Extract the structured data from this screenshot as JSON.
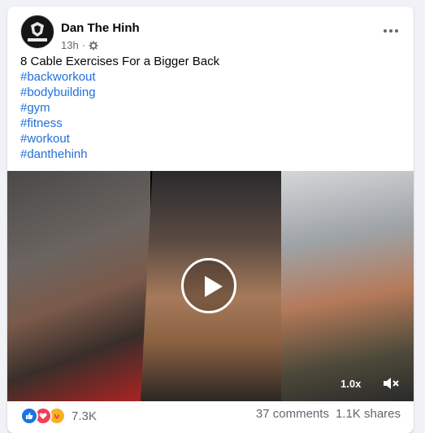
{
  "post": {
    "author": "Dan The Hinh",
    "avatar_text": "DAN THE HINH",
    "time": "13h",
    "privacy_icon": "settings-gear-icon",
    "text": "8 Cable Exercises For a Bigger Back",
    "hashtags": [
      "#backworkout",
      "#bodybuilding",
      "#gym",
      "#fitness",
      "#workout",
      "#danthehinh"
    ]
  },
  "video": {
    "playback_speed": "1.0x",
    "play_icon": "play-icon",
    "volume_icon": "volume-muted-icon"
  },
  "footer": {
    "reaction_icons": [
      "like-icon",
      "love-icon",
      "care-icon"
    ],
    "reaction_count": "7.3K",
    "comments": "37 comments",
    "shares": "1.1K shares"
  },
  "colors": {
    "hashtag": "#216fdb",
    "like": "#1b74e4",
    "love": "#f33e58",
    "care": "#f7b125"
  }
}
